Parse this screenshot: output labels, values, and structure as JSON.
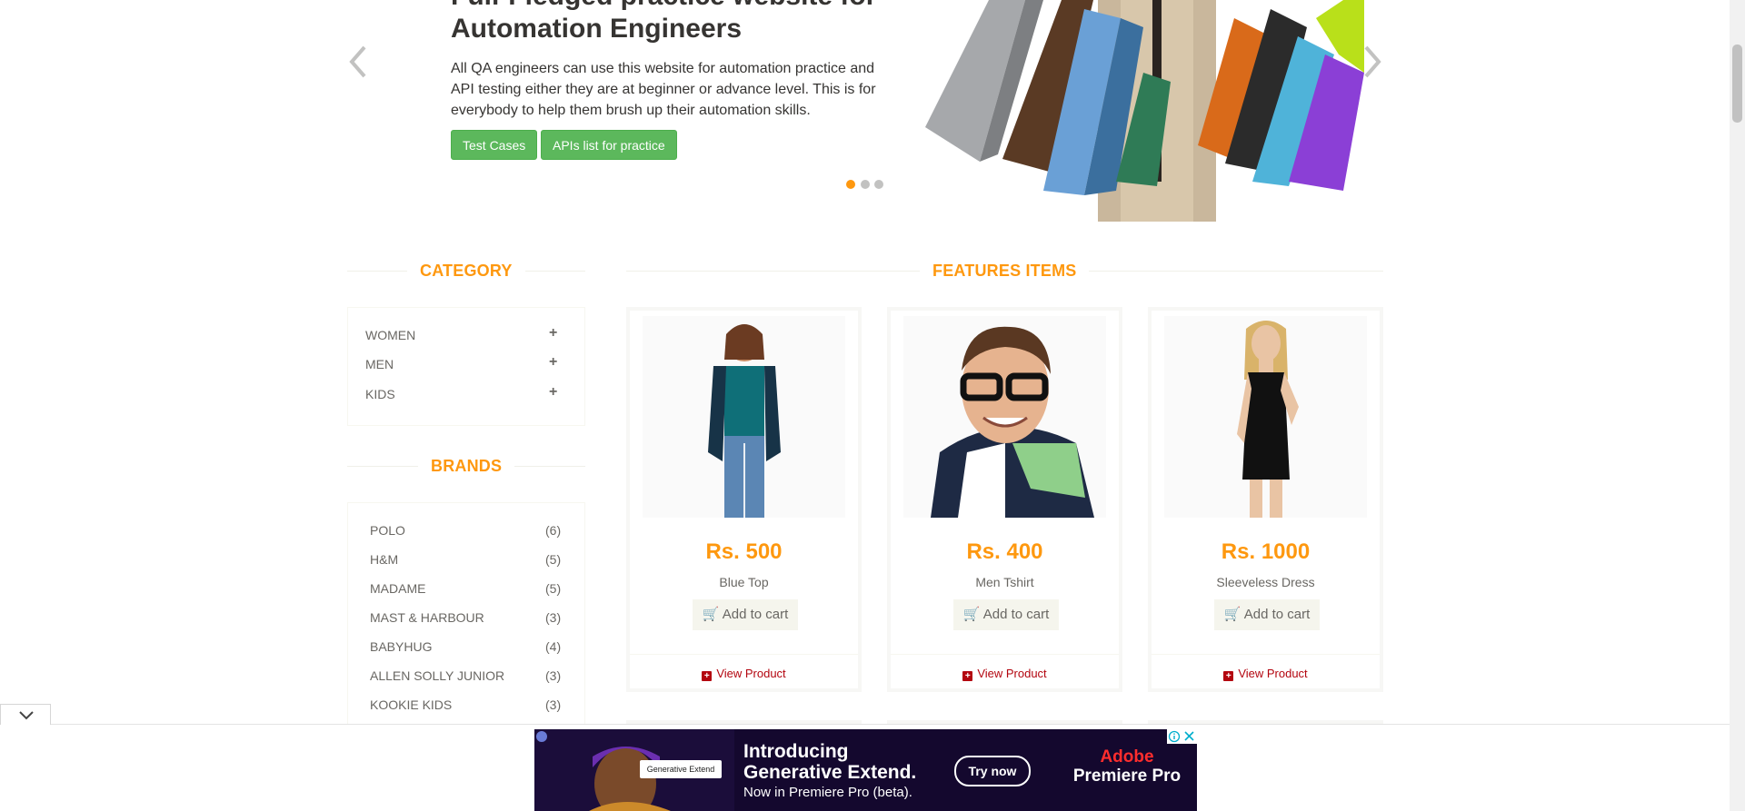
{
  "hero": {
    "title": "Full-Fledged practice website for\nAutomation Engineers",
    "text": "All QA engineers can use this website for automation practice and API testing either they are at beginner or advance level. This is for everybody to help them brush up their automation skills.",
    "btn_test_cases": "Test Cases",
    "btn_apis": "APIs list for practice",
    "active_slide": 1,
    "slide_count": 3
  },
  "sidebar": {
    "category_title": "CATEGORY",
    "categories": [
      {
        "label": "WOMEN",
        "icon": "plus-icon"
      },
      {
        "label": "MEN",
        "icon": "plus-icon"
      },
      {
        "label": "KIDS",
        "icon": "plus-icon"
      }
    ],
    "brands_title": "BRANDS",
    "brands": [
      {
        "name": "POLO",
        "count": "(6)"
      },
      {
        "name": "H&M",
        "count": "(5)"
      },
      {
        "name": "MADAME",
        "count": "(5)"
      },
      {
        "name": "MAST & HARBOUR",
        "count": "(3)"
      },
      {
        "name": "BABYHUG",
        "count": "(4)"
      },
      {
        "name": "ALLEN SOLLY JUNIOR",
        "count": "(3)"
      },
      {
        "name": "KOOKIE KIDS",
        "count": "(3)"
      }
    ]
  },
  "features": {
    "title": "FEATURES ITEMS",
    "add_to_cart": "Add to cart",
    "view_product": "View Product",
    "products": [
      {
        "price": "Rs. 500",
        "name": "Blue Top"
      },
      {
        "price": "Rs. 400",
        "name": "Men Tshirt"
      },
      {
        "price": "Rs. 1000",
        "name": "Sleeveless Dress"
      }
    ]
  },
  "ad": {
    "headline": "Introducing\nGenerative Extend.",
    "sub": "Now in Premiere Pro (beta).",
    "cta": "Try now",
    "brand_top": "Adobe",
    "brand_bottom": "Premiere Pro",
    "chip": "Generative Extend"
  },
  "colors": {
    "accent": "#fe980f",
    "button_green": "#5cb85c",
    "view_product_red": "#b3050f",
    "ad_background": "#14082e"
  }
}
